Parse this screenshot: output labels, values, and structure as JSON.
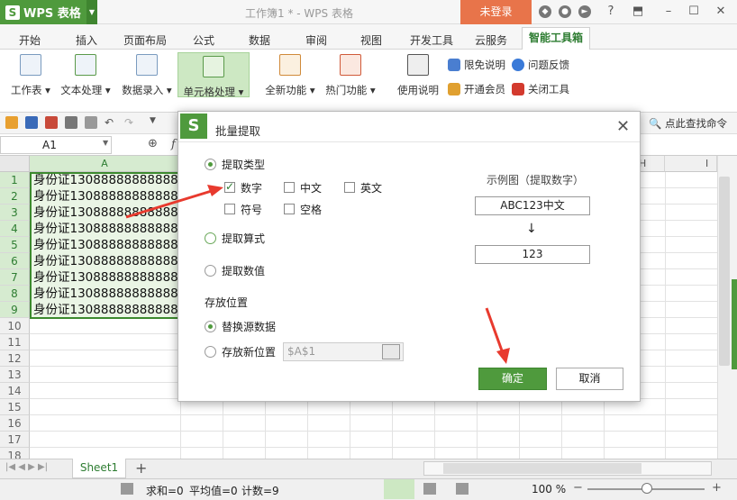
{
  "app": {
    "name": "WPS 表格",
    "doc_title": "工作簿1 * - WPS 表格",
    "login": "未登录"
  },
  "tabs": [
    "开始",
    "插入",
    "页面布局",
    "公式",
    "数据",
    "审阅",
    "视图",
    "开发工具",
    "云服务",
    "智能工具箱"
  ],
  "ribbon": {
    "buttons": [
      "工作表",
      "文本处理",
      "数据录入",
      "单元格处理",
      "全新功能",
      "热门功能",
      "使用说明"
    ],
    "small": [
      "限免说明",
      "问题反馈",
      "开通会员",
      "关闭工具"
    ]
  },
  "toolbar": {
    "find": "点此查找命令"
  },
  "formula": {
    "namebox": "A1"
  },
  "sheet": {
    "columns": [
      "A",
      "H",
      "I"
    ],
    "rows": [
      "1",
      "2",
      "3",
      "4",
      "5",
      "6",
      "7",
      "8",
      "9",
      "10",
      "11",
      "12",
      "13",
      "14",
      "15",
      "16",
      "17",
      "18"
    ],
    "cells": [
      "身份证130888888888888",
      "身份证130888888888888",
      "身份证130888888888888",
      "身份证130888888888888",
      "身份证130888888888888",
      "身份证130888888888888",
      "身份证130888888888888",
      "身份证130888888888888",
      "身份证130888888888888"
    ],
    "tab": "Sheet1"
  },
  "status": {
    "sum": "求和=0",
    "avg": "平均值=0",
    "count": "计数=9",
    "zoom": "100 %"
  },
  "dialog": {
    "title": "批量提取",
    "extract_type": "提取类型",
    "checks": [
      "数字",
      "中文",
      "英文",
      "符号",
      "空格"
    ],
    "formula": "提取算式",
    "value": "提取数值",
    "example_title": "示例图（提取数字）",
    "example_in": "ABC123中文",
    "example_out": "123",
    "store_pos": "存放位置",
    "replace": "替换源数据",
    "new_pos": "存放新位置",
    "new_pos_value": "$A$1",
    "ok": "确定",
    "cancel": "取消"
  },
  "colors": {
    "accent": "#4f9a3d",
    "login": "#e8744a",
    "arrow": "#e83a2e"
  }
}
